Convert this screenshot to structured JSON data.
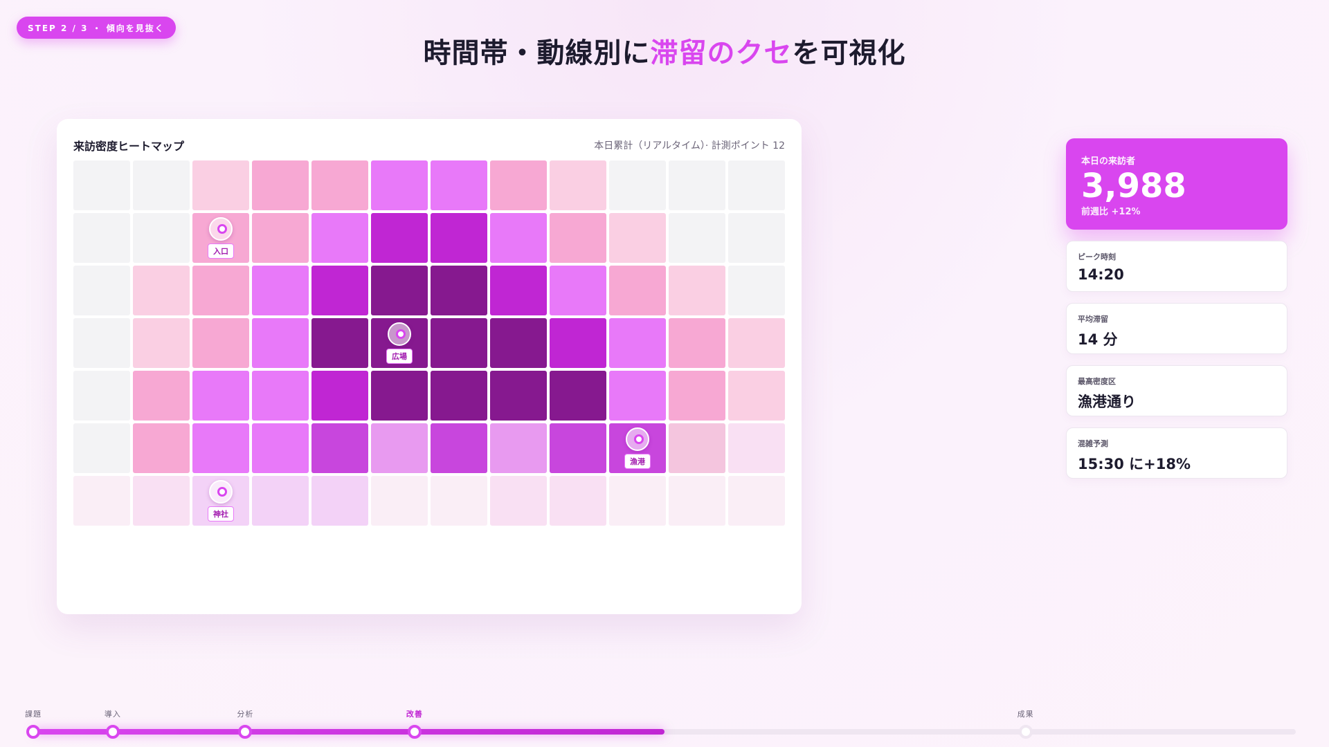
{
  "step_badge": "STEP 2 / 3 ・ 傾向を見抜く",
  "headline": {
    "pre": "時間帯・動線別に",
    "highlight": "滞留のクセ",
    "post": "を可視化"
  },
  "heatmap": {
    "title": "来訪密度ヒートマップ",
    "meta": "本日累計（リアルタイム）· 計測ポイント 12",
    "rows": [
      [
        0,
        0,
        1,
        2,
        2,
        3,
        3,
        2,
        1,
        0,
        0,
        0
      ],
      [
        0,
        0,
        2,
        2,
        3,
        4,
        4,
        3,
        2,
        1,
        0,
        0
      ],
      [
        0,
        1,
        2,
        3,
        4,
        5,
        5,
        4,
        3,
        2,
        1,
        0
      ],
      [
        0,
        1,
        2,
        3,
        5,
        5,
        5,
        5,
        4,
        3,
        2,
        1
      ],
      [
        0,
        2,
        3,
        3,
        4,
        5,
        5,
        5,
        5,
        3,
        2,
        1
      ],
      [
        0,
        2,
        3,
        3,
        7,
        8,
        7,
        8,
        7,
        7,
        9,
        10
      ],
      [
        11,
        10,
        12,
        12,
        12,
        11,
        11,
        10,
        10,
        11,
        11,
        11
      ]
    ],
    "palette": [
      "#f3f3f5",
      "#facfe3",
      "#f7a8d3",
      "#e879f9",
      "#c026d3",
      "#86198f",
      "#f3f3f5",
      "#c846dd",
      "#e89af0",
      "#f4c5de",
      "#f9e0f3",
      "#faeef6",
      "#f3d2f7"
    ],
    "markers": [
      {
        "label": "入口",
        "row": 1,
        "col": 2
      },
      {
        "label": "広場",
        "row": 3,
        "col": 5
      },
      {
        "label": "漁港",
        "row": 5,
        "col": 9
      },
      {
        "label": "神社",
        "row": 6,
        "col": 2
      }
    ]
  },
  "kpis": {
    "main": {
      "label": "本日の来訪者",
      "value": "3,988",
      "sub": "前週比 +12%"
    },
    "items": [
      {
        "label": "ピーク時刻",
        "value": "14:20"
      },
      {
        "label": "平均滞留",
        "value": "14 分"
      },
      {
        "label": "最高密度区",
        "value": "漁港通り"
      },
      {
        "label": "混雑予測",
        "value": "15:30 に+18%"
      }
    ]
  },
  "timeline": {
    "progress": 0.5,
    "stages": [
      {
        "label": "課題",
        "pos": 0.0,
        "active": false,
        "done": true
      },
      {
        "label": "導入",
        "pos": 0.063,
        "active": false,
        "done": true
      },
      {
        "label": "分析",
        "pos": 0.168,
        "active": false,
        "done": true
      },
      {
        "label": "改善",
        "pos": 0.302,
        "active": true,
        "done": true
      },
      {
        "label": "成果",
        "pos": 0.786,
        "active": false,
        "done": false
      }
    ]
  }
}
